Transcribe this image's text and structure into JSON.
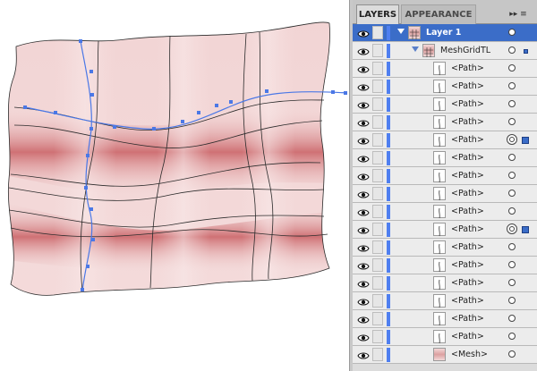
{
  "colors": {
    "selection_blue": "#3b6dc8",
    "layer_color_bar": "#4f7ff0",
    "mesh_base": "#e8c1c1",
    "mesh_band": "#c96565",
    "path_highlight": "#4b78e6"
  },
  "panel": {
    "tabs": [
      {
        "label": "LAYERS",
        "active": true
      },
      {
        "label": "APPEARANCE",
        "active": false
      }
    ],
    "menu_icon": "panel-menu-icon",
    "rows": [
      {
        "label": "Layer 1",
        "type": "layer",
        "selected": true,
        "thumb": "layer-thumb-icon",
        "target": "single",
        "selection": "none"
      },
      {
        "label": "MeshGridTL",
        "type": "group",
        "selected": false,
        "thumb": "group-thumb-icon",
        "target": "single",
        "selection": "small"
      },
      {
        "label": "<Path>",
        "type": "path",
        "selected": false,
        "thumb": "path-thumb-icon",
        "target": "single",
        "selection": "none"
      },
      {
        "label": "<Path>",
        "type": "path",
        "selected": false,
        "thumb": "path-thumb-icon",
        "target": "single",
        "selection": "none"
      },
      {
        "label": "<Path>",
        "type": "path",
        "selected": false,
        "thumb": "path-thumb-icon",
        "target": "single",
        "selection": "none"
      },
      {
        "label": "<Path>",
        "type": "path",
        "selected": false,
        "thumb": "path-thumb-icon",
        "target": "single",
        "selection": "none"
      },
      {
        "label": "<Path>",
        "type": "path",
        "selected": false,
        "thumb": "path-thumb-icon",
        "target": "double",
        "selection": "box"
      },
      {
        "label": "<Path>",
        "type": "path",
        "selected": false,
        "thumb": "path-thumb-icon",
        "target": "single",
        "selection": "none"
      },
      {
        "label": "<Path>",
        "type": "path",
        "selected": false,
        "thumb": "path-thumb-icon",
        "target": "single",
        "selection": "none"
      },
      {
        "label": "<Path>",
        "type": "path",
        "selected": false,
        "thumb": "path-thumb-icon",
        "target": "single",
        "selection": "none"
      },
      {
        "label": "<Path>",
        "type": "path",
        "selected": false,
        "thumb": "path-thumb-icon",
        "target": "single",
        "selection": "none"
      },
      {
        "label": "<Path>",
        "type": "path",
        "selected": false,
        "thumb": "path-thumb-icon",
        "target": "double",
        "selection": "box"
      },
      {
        "label": "<Path>",
        "type": "path",
        "selected": false,
        "thumb": "path-thumb-icon",
        "target": "single",
        "selection": "none"
      },
      {
        "label": "<Path>",
        "type": "path",
        "selected": false,
        "thumb": "path-thumb-icon",
        "target": "single",
        "selection": "none"
      },
      {
        "label": "<Path>",
        "type": "path",
        "selected": false,
        "thumb": "path-thumb-icon",
        "target": "single",
        "selection": "none"
      },
      {
        "label": "<Path>",
        "type": "path",
        "selected": false,
        "thumb": "path-thumb-icon",
        "target": "single",
        "selection": "none"
      },
      {
        "label": "<Path>",
        "type": "path",
        "selected": false,
        "thumb": "path-thumb-icon",
        "target": "single",
        "selection": "none"
      },
      {
        "label": "<Path>",
        "type": "path",
        "selected": false,
        "thumb": "path-thumb-icon",
        "target": "single",
        "selection": "none"
      },
      {
        "label": "<Mesh>",
        "type": "mesh",
        "selected": false,
        "thumb": "mesh-thumb-icon",
        "target": "single",
        "selection": "none"
      }
    ]
  },
  "canvas": {
    "artwork": "gradient-mesh-plaid"
  }
}
